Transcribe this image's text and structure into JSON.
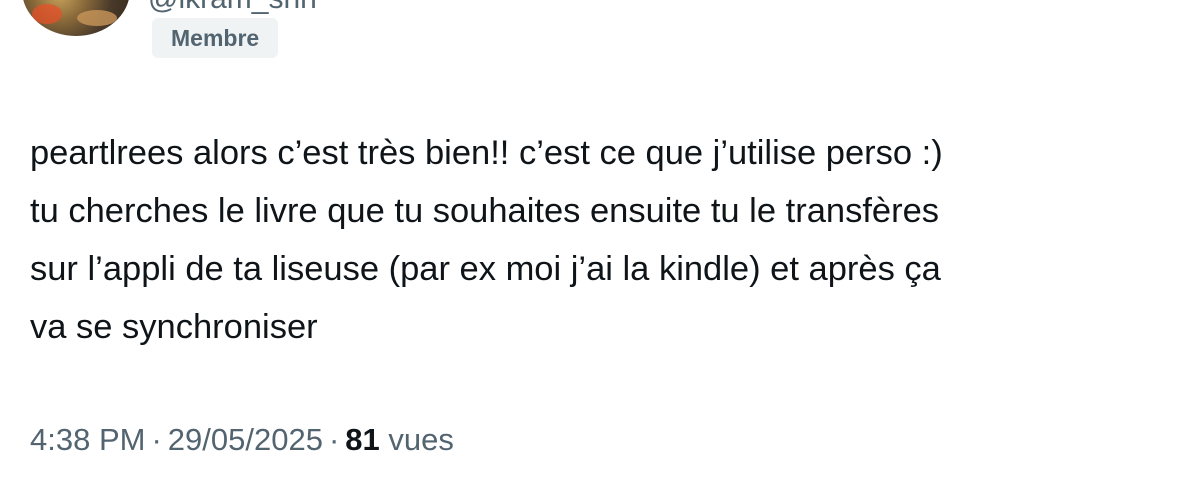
{
  "author": {
    "handle": "@ikram_shn",
    "role_badge": "Membre"
  },
  "tweet": {
    "lines": [
      "peartlrees alors c’est très bien!! c’est ce que j’utilise perso :)",
      "tu cherches le livre que tu souhaites ensuite tu le transfères",
      "sur l’appli de ta liseuse (par ex moi j’ai la kindle) et après ça",
      "va se synchroniser"
    ]
  },
  "meta": {
    "time": "4:38 PM",
    "separator": "·",
    "date": "29/05/2025",
    "views_count": "81",
    "views_label": "vues"
  }
}
